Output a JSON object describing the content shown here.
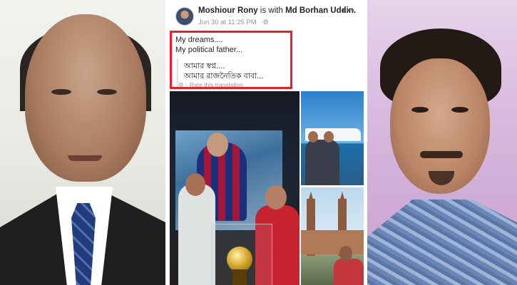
{
  "post": {
    "author": "Moshiour Rony",
    "with_text": "is with",
    "tagged": "Md Borhan Uddin.",
    "timestamp": "Jun 30 at 11:25 PM",
    "more_icon": "more-options-icon",
    "lines": [
      "My dreams....",
      "My political father..."
    ],
    "translation_lines": [
      "আমার স্বপ্ন....",
      "আমার রাজনৈতিক বাবা..."
    ],
    "rate_translation": "Rate this translation"
  },
  "colors": {
    "highlight": "#e8202a",
    "facebook_text": "#1d2129",
    "meta_text": "#90949c"
  }
}
